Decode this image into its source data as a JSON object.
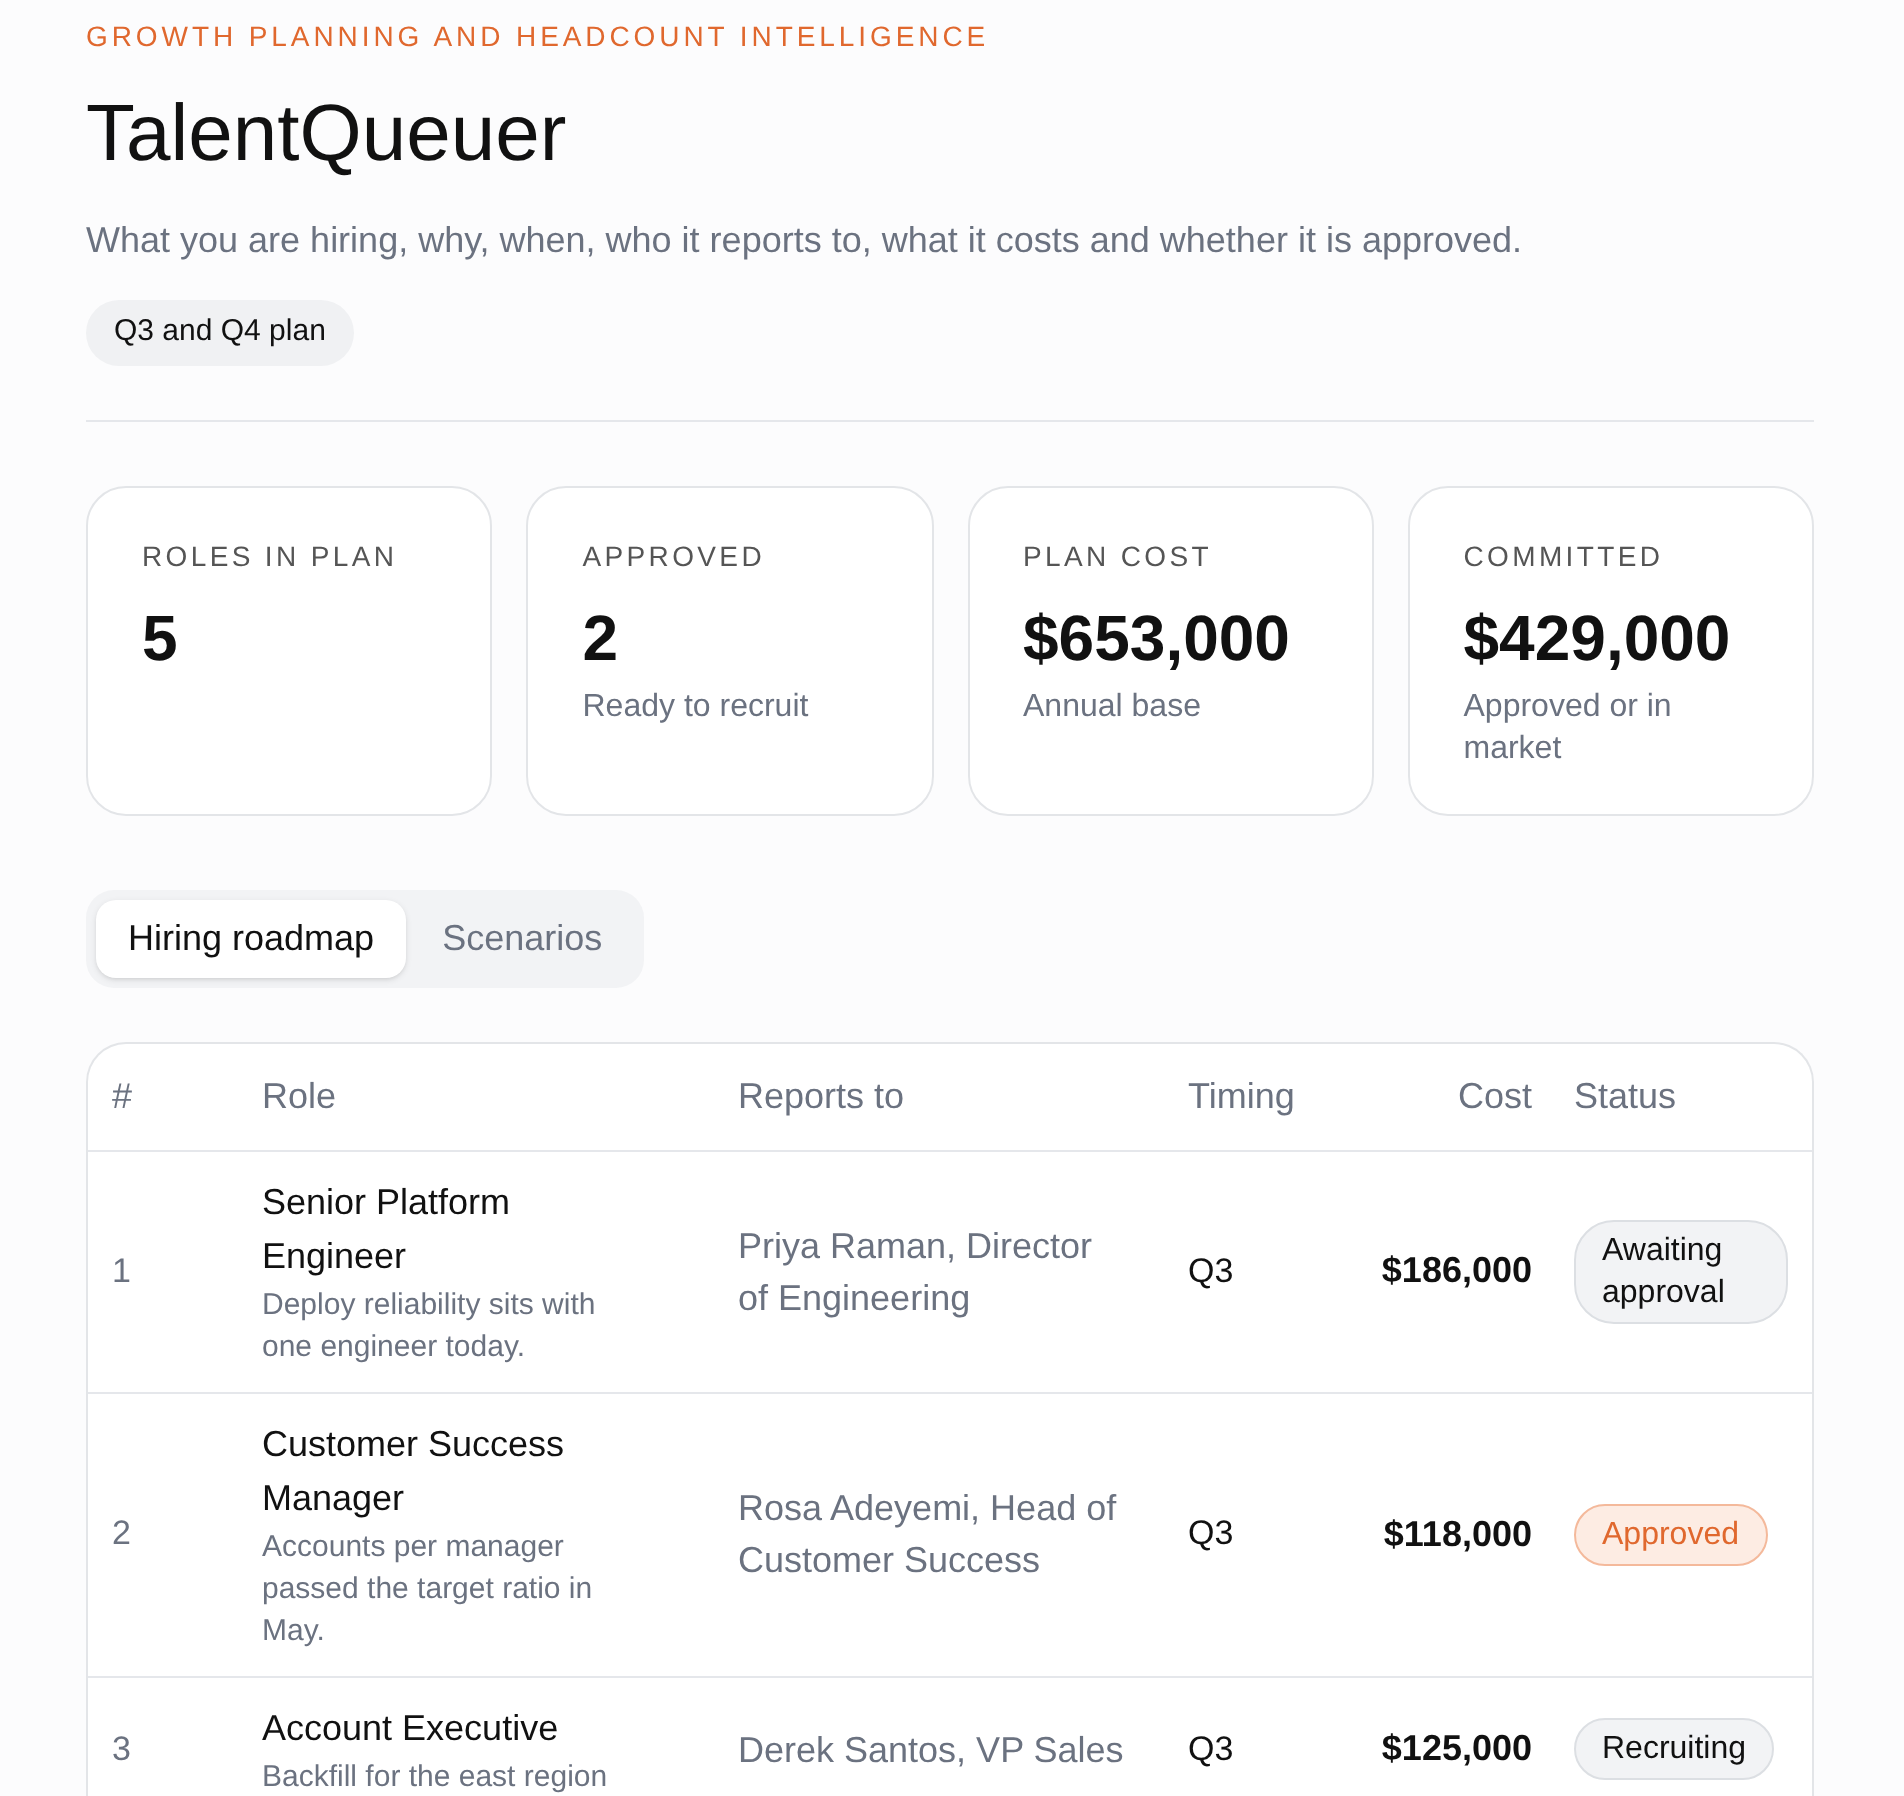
{
  "eyebrow": "GROWTH PLANNING AND HEADCOUNT INTELLIGENCE",
  "title": "TalentQueuer",
  "subtitle": "What you are hiring, why, when, who it reports to, what it costs and whether it is approved.",
  "plan_badge": "Q3 and Q4 plan",
  "stats": [
    {
      "label": "ROLES IN PLAN",
      "value": "5"
    },
    {
      "label": "APPROVED",
      "value": "2",
      "note": "Ready to recruit"
    },
    {
      "label": "PLAN COST",
      "value": "$653,000",
      "note": "Annual base"
    },
    {
      "label": "COMMITTED",
      "value": "$429,000",
      "note": "Approved or in market"
    }
  ],
  "tabs": [
    {
      "label": "Hiring roadmap",
      "selected": true
    },
    {
      "label": "Scenarios",
      "selected": false
    }
  ],
  "table": {
    "columns": [
      "#",
      "Role",
      "Reports to",
      "Timing",
      "Cost",
      "Status"
    ],
    "rows": [
      {
        "number": "1",
        "role": "Senior Platform Engineer",
        "reason": "Deploy reliability sits with one engineer today.",
        "reports_to": "Priya Raman, Director of Engineering",
        "timing": "Q3",
        "cost": "$186,000",
        "status": "Awaiting approval",
        "kind": "pending"
      },
      {
        "number": "2",
        "role": "Customer Success Manager",
        "reason": "Accounts per manager passed the target ratio in May.",
        "reports_to": "Rosa Adeyemi, Head of Customer Success",
        "timing": "Q3",
        "cost": "$118,000",
        "status": "Approved",
        "kind": "approved"
      },
      {
        "number": "3",
        "role": "Account Executive",
        "reason": "Backfill for the east region",
        "reports_to": "Derek Santos, VP Sales",
        "timing": "Q3",
        "cost": "$125,000",
        "status": "Recruiting",
        "kind": "recruiting"
      }
    ]
  }
}
